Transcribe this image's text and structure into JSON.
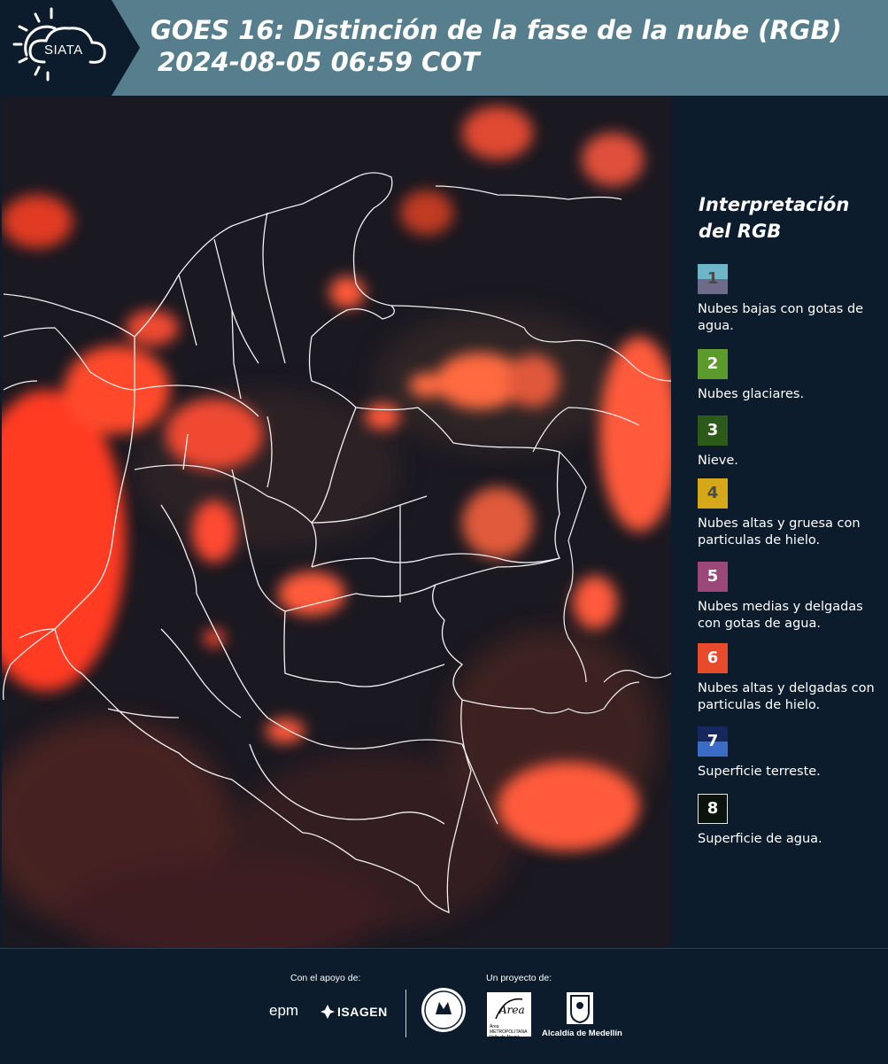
{
  "header": {
    "logo_text": "SIATA",
    "title_line1": "GOES 16: Distinción de la fase de la nube (RGB)",
    "title_line2": "2024-08-05 06:59 COT",
    "bg_color": "#567e8d"
  },
  "legend": {
    "title": "Interpretación del RGB",
    "items": [
      {
        "number": "1",
        "label": "Nubes bajas con gotas de agua.",
        "colors": [
          "#6cb6c8",
          "#6d6a8a"
        ]
      },
      {
        "number": "2",
        "label": "Nubes glaciares.",
        "colors": [
          "#5c9a2c"
        ]
      },
      {
        "number": "3",
        "label": "Nieve.",
        "colors": [
          "#2c5a18"
        ]
      },
      {
        "number": "4",
        "label": "Nubes altas y gruesa con particulas de hielo.",
        "colors": [
          "#d4a818"
        ]
      },
      {
        "number": "5",
        "label": "Nubes medias y delgadas con gotas de agua.",
        "colors": [
          "#9a4878"
        ]
      },
      {
        "number": "6",
        "label": "Nubes altas y delgadas con particulas de hielo.",
        "colors": [
          "#e84a2c"
        ]
      },
      {
        "number": "7",
        "label": "Superficie terreste.",
        "colors": [
          "#16275e",
          "#3a6cc6"
        ]
      },
      {
        "number": "8",
        "label": "Superficie de agua.",
        "colors": [
          "#0a140c"
        ]
      }
    ]
  },
  "footer": {
    "support_label": "Con el apoyo de:",
    "project_label": "Un proyecto de:",
    "epm": "epm",
    "isagen": "ISAGEN",
    "area_metropolitana": "Área METROPOLITANA Valle de Aburrá",
    "alcaldia": "Alcaldía de Medellín"
  }
}
